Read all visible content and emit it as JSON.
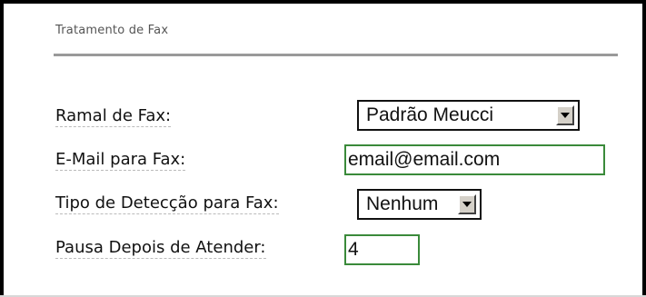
{
  "section": {
    "title": "Tratamento de Fax"
  },
  "fields": {
    "ramal": {
      "label": "Ramal de Fax:",
      "value": "Padrão Meucci"
    },
    "email": {
      "label": "E-Mail para Fax:",
      "value": "email@email.com"
    },
    "deteccao": {
      "label": "Tipo de Detecção para Fax:",
      "value": "Nenhum"
    },
    "pausa": {
      "label": "Pausa Depois de Atender:",
      "value": "4"
    }
  },
  "colors": {
    "textbox_border": "#3a8a3a",
    "rule": "#9a9a9a"
  }
}
